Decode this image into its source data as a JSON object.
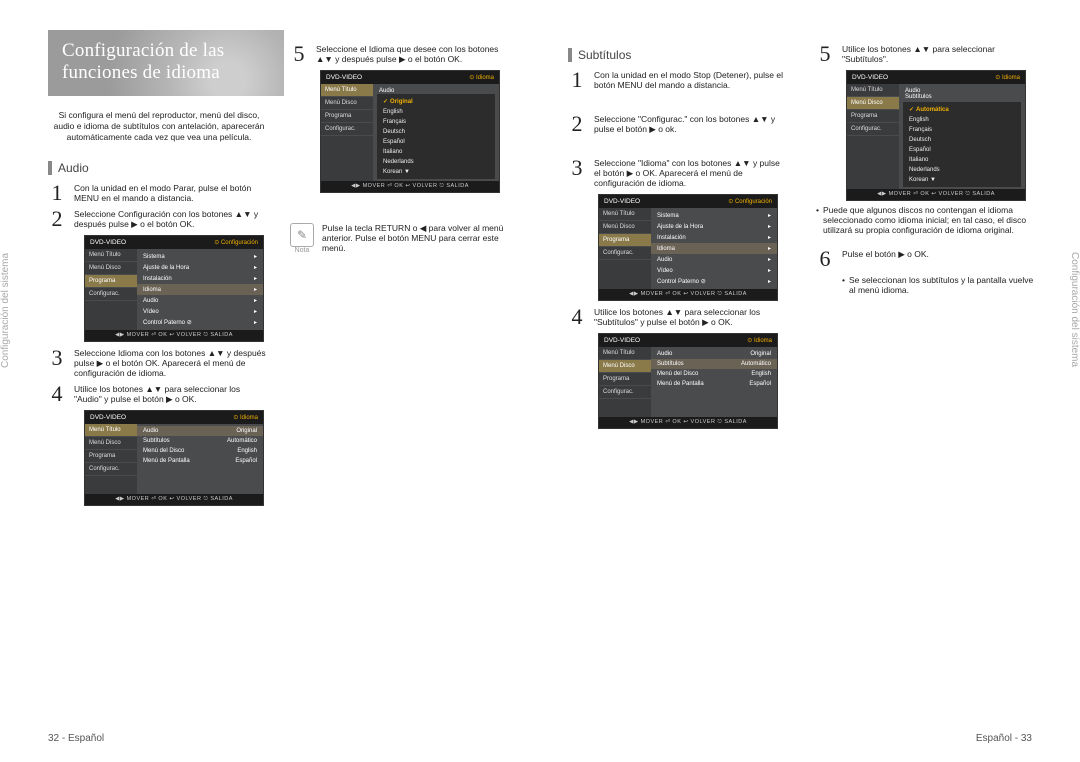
{
  "tab_text": "Configuración del sistema",
  "left": {
    "title": "Configuración de las funciones de idioma",
    "intro": "Si configura el menú del reproductor, menú del disco, audio e idioma de subtítulos con antelación, aparecerán automáticamente cada vez que vea una película.",
    "audio_heading": "Audio",
    "steps": {
      "s1": "Con la unidad en el modo Parar, pulse el botón MENU en el mando a distancia.",
      "s2": "Seleccione Configuración con los botones ▲▼ y después pulse ▶ o el botón OK.",
      "s3": "Seleccione Idioma con los botones ▲▼ y después pulse ▶ o el botón OK. Aparecerá el menú de configuración de idioma.",
      "s4": "Utilice los botones ▲▼ para seleccionar los \"Audio\" y pulse el botón ▶ o OK.",
      "s5": "Seleccione el Idioma que desee con los botones ▲▼ y después pulse ▶ o el botón OK."
    },
    "note_label": "Nota",
    "note_text": "Pulse la tecla RETURN o ◀ para volver al menú anterior. Pulse el botón MENU para cerrar este menú.",
    "page_label": "32 - Español"
  },
  "right": {
    "sub_heading": "Subtítulos",
    "steps": {
      "s1": "Con la unidad en el modo Stop (Detener), pulse el botón MENU del mando a distancia.",
      "s2": "Seleccione \"Configurac.\" con los botones ▲▼ y pulse el botón ▶ o ok.",
      "s3": "Seleccione \"Idioma\" con los botones ▲▼ y pulse el botón ▶ o OK. Aparecerá el menú de configuración de idioma.",
      "s4": "Utilice los botones ▲▼ para seleccionar los \"Subtítulos\" y pulse el botón ▶ o OK.",
      "s5": "Utilice los botones ▲▼ para seleccionar \"Subtítulos\".",
      "s6": "Pulse el botón ▶ o OK."
    },
    "bullet1": "Puede que algunos discos no contengan el idioma seleccionado como idioma inicial; en tal caso, el disco utilizará su propia configuración de idioma original.",
    "bullet2": "Se seleccionan los subtítulos y la pantalla vuelve al menú idioma.",
    "page_label": "Español - 33"
  },
  "osd": {
    "title": "DVD-VIDEO",
    "badge_config": "⊙ Configuración",
    "badge_idioma": "⊙ Idioma",
    "side": [
      "Menú Título",
      "Menú Disco",
      "Programa",
      "Configurac."
    ],
    "config_rows": [
      "Sistema",
      "Ajuste de la Hora",
      "Instalación",
      "Idioma",
      "Audio",
      "Vídeo",
      "Control Paterno ⊘"
    ],
    "idioma_rows": [
      {
        "l": "Audio",
        "r": "Original"
      },
      {
        "l": "Subtítulos",
        "r": "Automático"
      },
      {
        "l": "Menú del Disco",
        "r": "English"
      },
      {
        "l": "Menú de Pantalla",
        "r": "Español"
      }
    ],
    "lang_list": [
      "Original",
      "English",
      "Français",
      "Deutsch",
      "Español",
      "Italiano",
      "Nederlands",
      "Korean ▼"
    ],
    "sub_list": [
      "Automática",
      "English",
      "Français",
      "Deutsch",
      "Español",
      "Italiano",
      "Nederlands",
      "Korean ▼"
    ],
    "foot": "◀▶ MOVER   ⏎ OK   ↩ VOLVER   ⎋ SALIDA"
  }
}
